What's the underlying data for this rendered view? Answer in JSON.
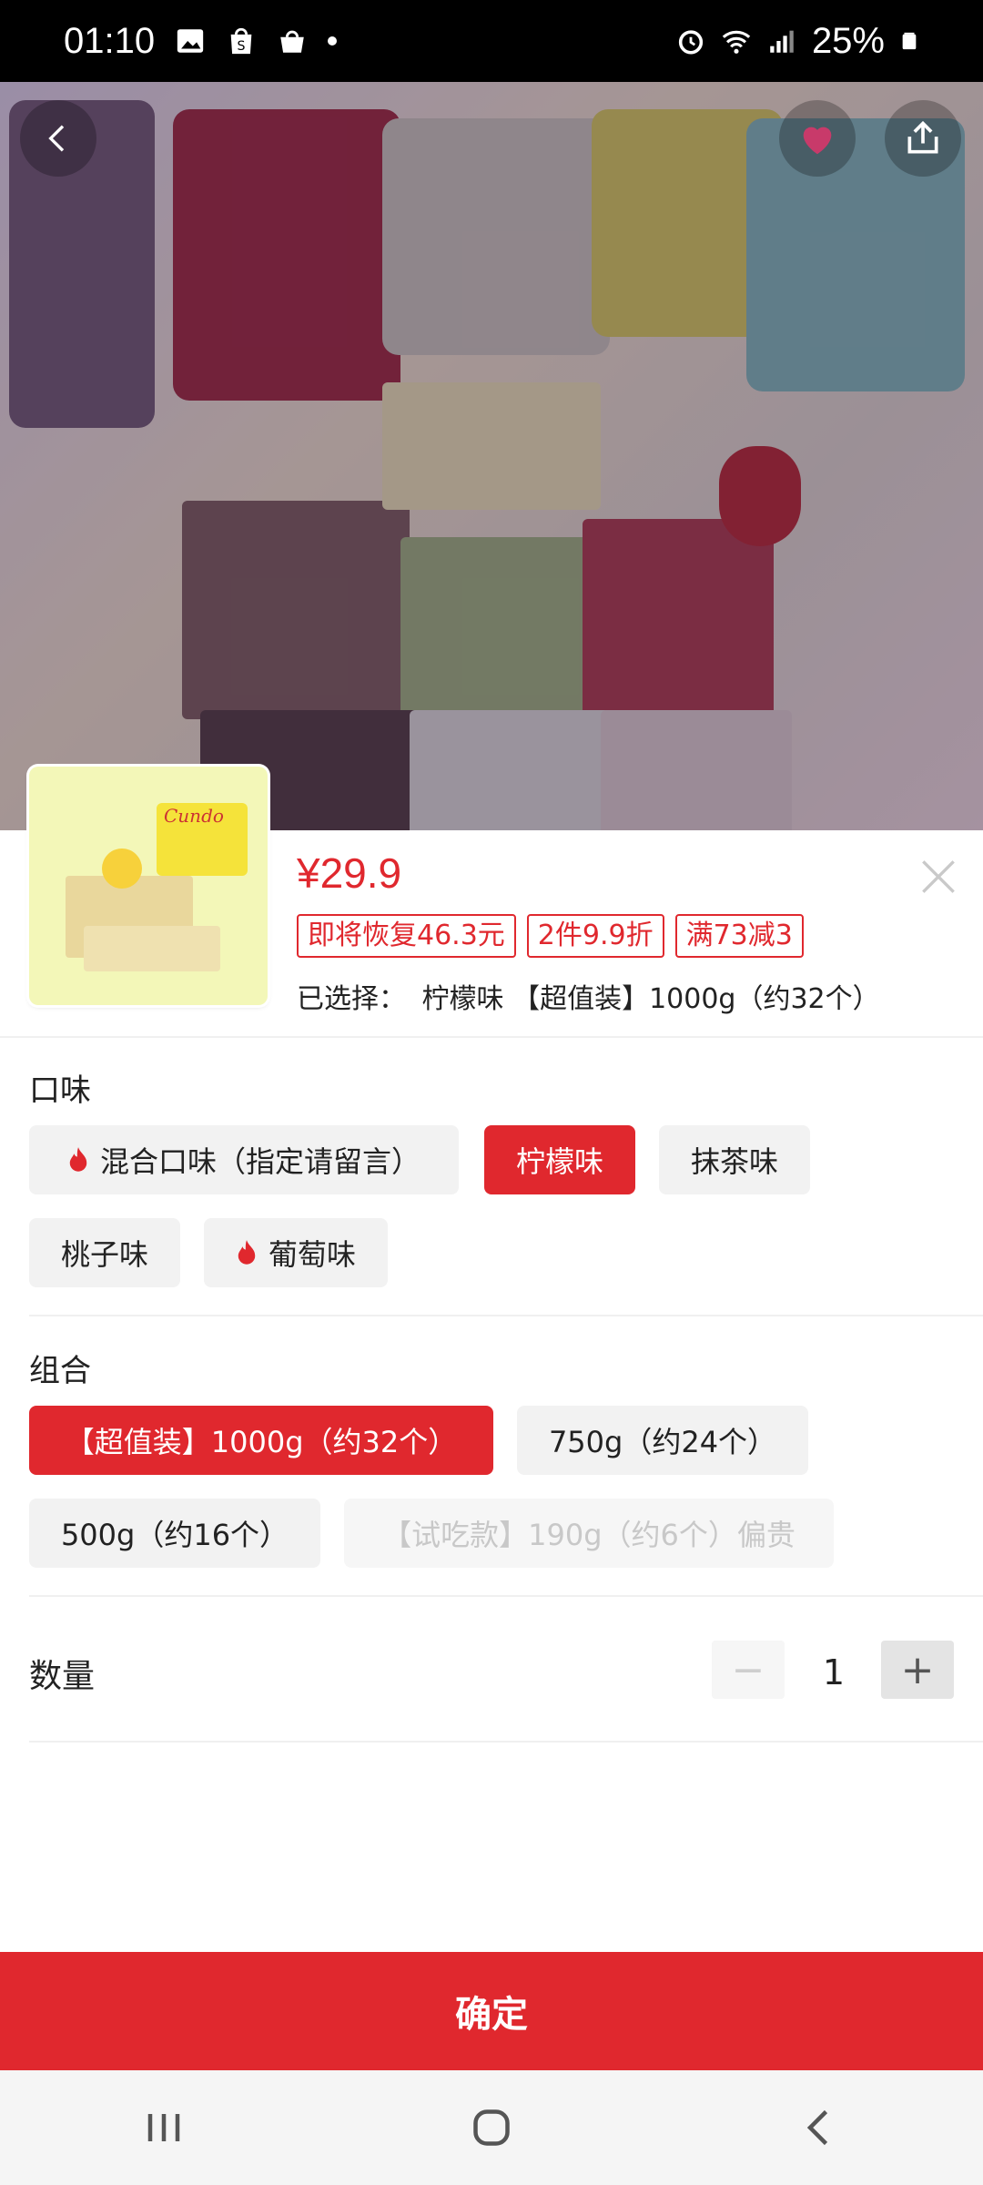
{
  "status_bar": {
    "time": "01:10",
    "battery": "25%",
    "icons_left": [
      "image-icon",
      "shop-icon",
      "bag-icon",
      "dot-icon"
    ],
    "icons_right": [
      "alarm-icon",
      "wifi-icon",
      "signal-icon",
      "battery-icon"
    ]
  },
  "hero": {
    "brand_text": "Cundo"
  },
  "product": {
    "price": "¥29.9",
    "tags": [
      "即将恢复46.3元",
      "2件9.9折",
      "满73减3"
    ],
    "selected_label": "已选择：",
    "selected_value": "柠檬味 【超值装】1000g（约32个）"
  },
  "flavor": {
    "title": "口味",
    "options": [
      {
        "label": "混合口味（指定请留言）",
        "hot": true,
        "state": "normal"
      },
      {
        "label": "柠檬味",
        "hot": false,
        "state": "active"
      },
      {
        "label": "抹茶味",
        "hot": false,
        "state": "normal"
      },
      {
        "label": "桃子味",
        "hot": false,
        "state": "normal"
      },
      {
        "label": "葡萄味",
        "hot": true,
        "state": "normal"
      }
    ]
  },
  "combo": {
    "title": "组合",
    "options": [
      {
        "label": "【超值装】1000g（约32个）",
        "state": "active"
      },
      {
        "label": "750g（约24个）",
        "state": "normal"
      },
      {
        "label": "500g（约16个）",
        "state": "normal"
      },
      {
        "label": "【试吃款】190g（约6个）偏贵",
        "state": "disabled"
      }
    ]
  },
  "quantity": {
    "label": "数量",
    "value": "1",
    "minus": "−",
    "plus": "+"
  },
  "confirm_label": "确定",
  "colors": {
    "accent": "#e0282e",
    "chip_bg": "#f2f2f2"
  }
}
